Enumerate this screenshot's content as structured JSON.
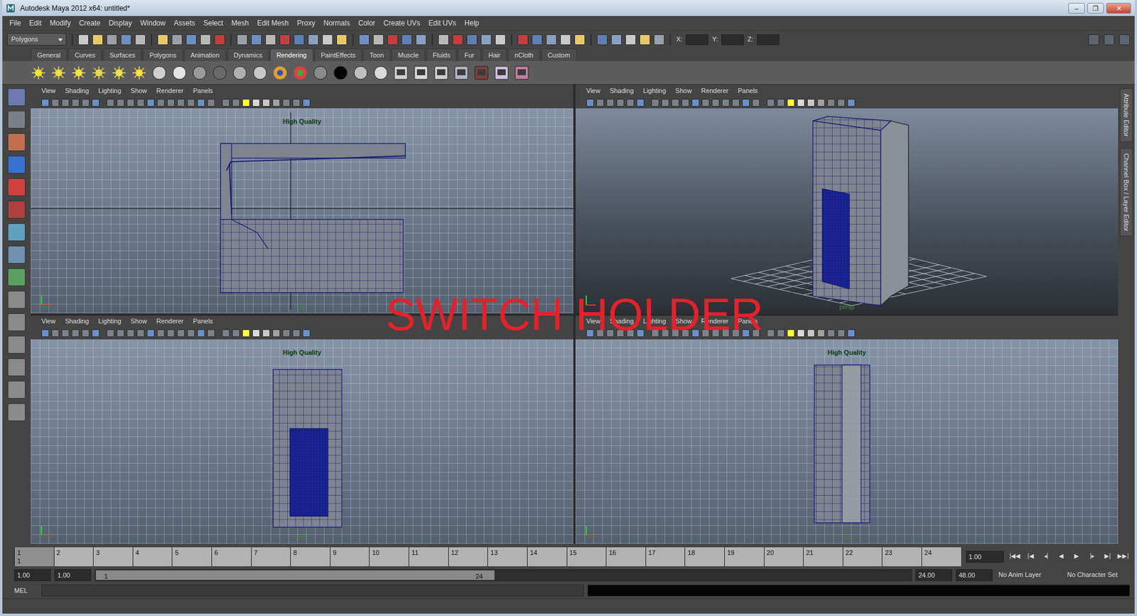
{
  "window": {
    "title": "Autodesk Maya 2012 x64: untitled*",
    "controls": [
      "–",
      "❐",
      "✕"
    ]
  },
  "menu": [
    "File",
    "Edit",
    "Modify",
    "Create",
    "Display",
    "Window",
    "Assets",
    "Select",
    "Mesh",
    "Edit Mesh",
    "Proxy",
    "Normals",
    "Color",
    "Create UVs",
    "Edit UVs",
    "Help"
  ],
  "status_line": {
    "mode": "Polygons",
    "fields": [
      {
        "label": "X:"
      },
      {
        "label": "Y:"
      },
      {
        "label": "Z:"
      }
    ]
  },
  "shelf": {
    "tabs": [
      {
        "label": "General",
        "selected": false
      },
      {
        "label": "Curves",
        "selected": false
      },
      {
        "label": "Surfaces",
        "selected": false
      },
      {
        "label": "Polygons",
        "selected": false
      },
      {
        "label": "Animation",
        "selected": false
      },
      {
        "label": "Dynamics",
        "selected": false
      },
      {
        "label": "Rendering",
        "selected": true
      },
      {
        "label": "PaintEffects",
        "selected": false
      },
      {
        "label": "Toon",
        "selected": false
      },
      {
        "label": "Muscle",
        "selected": false
      },
      {
        "label": "Fluids",
        "selected": false
      },
      {
        "label": "Fur",
        "selected": false
      },
      {
        "label": "Hair",
        "selected": false
      },
      {
        "label": "nCloth",
        "selected": false
      },
      {
        "label": "Custom",
        "selected": false
      }
    ]
  },
  "viewports": [
    {
      "kind": "top",
      "menu": [
        "View",
        "Shading",
        "Lighting",
        "Show",
        "Renderer",
        "Panels"
      ],
      "quality": "High Quality",
      "camera": "top"
    },
    {
      "kind": "persp",
      "menu": [
        "View",
        "Shading",
        "Lighting",
        "Show",
        "Renderer",
        "Panels"
      ],
      "camera": "persp"
    },
    {
      "kind": "front",
      "menu": [
        "View",
        "Shading",
        "Lighting",
        "Show",
        "Renderer",
        "Panels"
      ],
      "quality": "High Quality",
      "camera": "front"
    },
    {
      "kind": "side",
      "menu": [
        "View",
        "Shading",
        "Lighting",
        "Show",
        "Renderer",
        "Panels"
      ],
      "quality": "High Quality",
      "camera": "side"
    }
  ],
  "side_tabs": [
    "Attribute Editor",
    "Channel Box / Layer Editor"
  ],
  "watermark": "SWITCH HOLDER",
  "timeline": {
    "ticks": [
      "1",
      "2",
      "3",
      "4",
      "5",
      "6",
      "7",
      "8",
      "9",
      "10",
      "11",
      "12",
      "13",
      "14",
      "15",
      "16",
      "17",
      "18",
      "19",
      "20",
      "21",
      "22",
      "23",
      "24"
    ],
    "current_frame": "1",
    "current_time": "1.00",
    "playback": [
      "|◀◀",
      "|◀",
      "◂|",
      "◀",
      "▶",
      "|▸",
      "▶|",
      "▶▶|"
    ]
  },
  "range": {
    "start": "1.00",
    "playback_start": "1.00",
    "slider_start": "1",
    "slider_end": "24",
    "level": 0.49,
    "playback_end": "24.00",
    "end": "48.00",
    "anim_layer": "No Anim Layer",
    "character_set": "No Character Set"
  },
  "command_line": {
    "language": "MEL"
  }
}
